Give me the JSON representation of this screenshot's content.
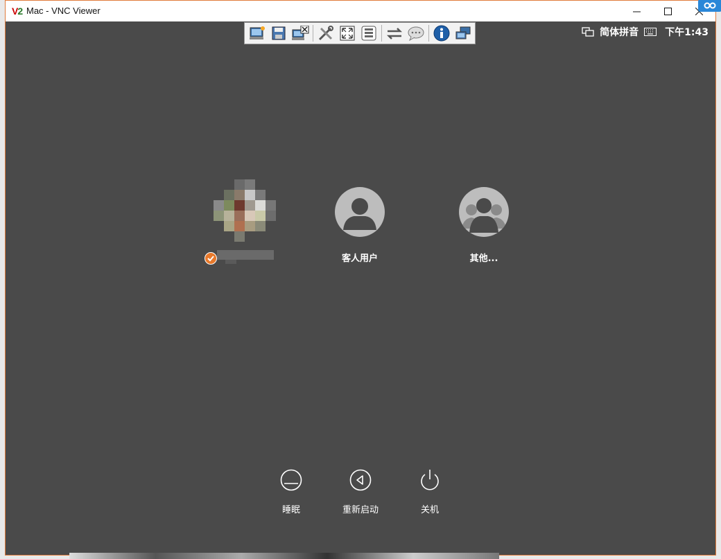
{
  "window": {
    "title": "Mac - VNC Viewer",
    "app_icon": "V2",
    "accent_color": "#e07a3a"
  },
  "toolbar": {
    "buttons": [
      {
        "name": "new-connection-icon"
      },
      {
        "name": "save-icon"
      },
      {
        "name": "close-connection-icon"
      },
      {
        "name": "options-icon"
      },
      {
        "name": "full-screen-icon"
      },
      {
        "name": "ctrl-alt-del-icon"
      },
      {
        "name": "transfer-icon"
      },
      {
        "name": "chat-icon"
      },
      {
        "name": "info-icon"
      },
      {
        "name": "connections-icon"
      }
    ]
  },
  "menubar": {
    "input_method": "简体拼音",
    "clock": "下午1:43"
  },
  "users": [
    {
      "label": "",
      "selected": true
    },
    {
      "label": "客人用户"
    },
    {
      "label": "其他..."
    }
  ],
  "power": {
    "sleep": "睡眠",
    "restart": "重新启动",
    "shutdown": "关机"
  },
  "colors": {
    "screen_bg": "#4a4a4a",
    "avatar_bg": "#bdbdbd",
    "check_badge": "#e8792b"
  }
}
